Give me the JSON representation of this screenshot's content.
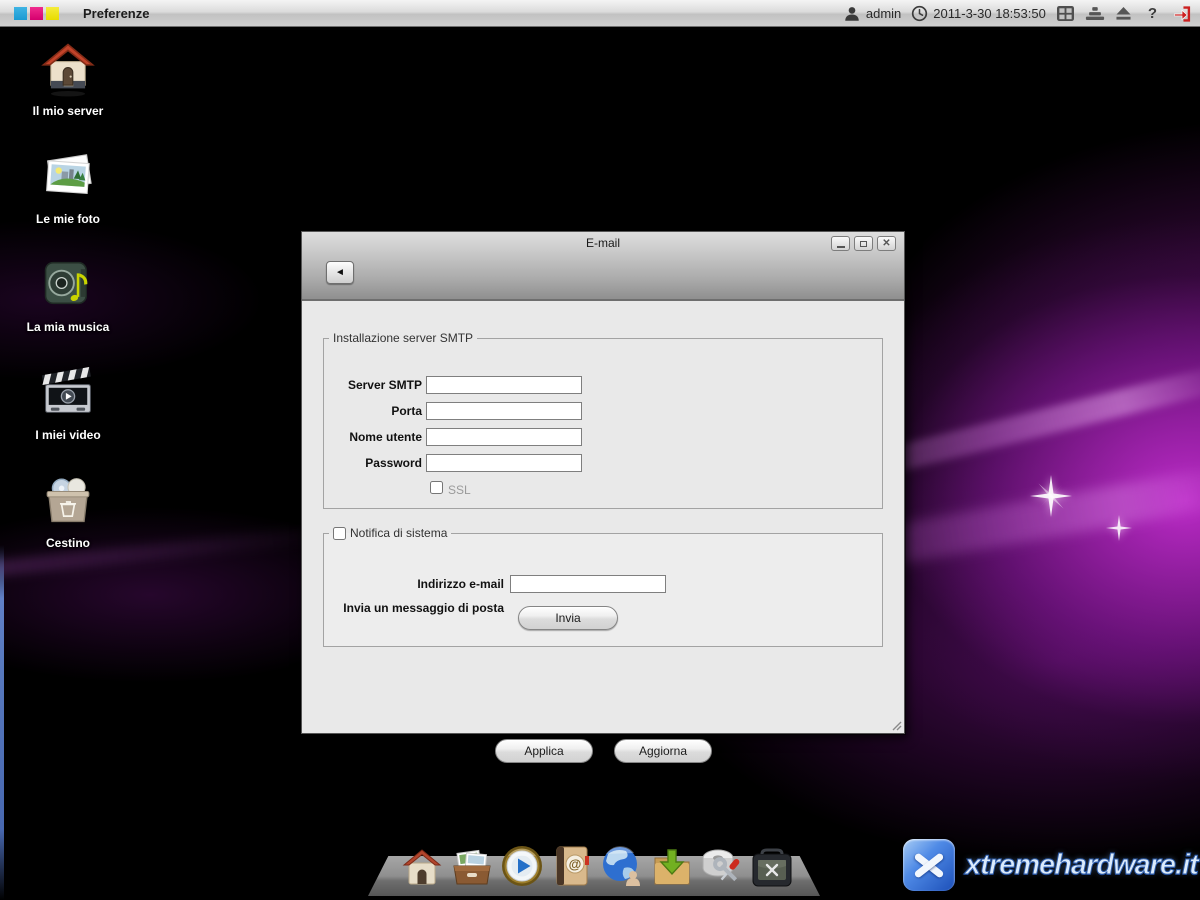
{
  "topbar": {
    "menu_label": "Preferenze",
    "user_name": "admin",
    "datetime": "2011-3-30 18:53:50",
    "help_glyph": "?"
  },
  "desktop_icons": [
    {
      "name": "my-server",
      "label": "Il mio server"
    },
    {
      "name": "my-photos",
      "label": "Le mie foto"
    },
    {
      "name": "my-music",
      "label": "La mia musica"
    },
    {
      "name": "my-videos",
      "label": "I miei video"
    },
    {
      "name": "recycle-bin",
      "label": "Cestino"
    }
  ],
  "dialog": {
    "title": "E-mail",
    "back_glyph": "◄",
    "minimize_glyph": "",
    "close_glyph": "",
    "smtp_section": {
      "legend": "Installazione server SMTP",
      "fields": [
        {
          "label": "Server SMTP",
          "value": ""
        },
        {
          "label": "Porta",
          "value": ""
        },
        {
          "label": "Nome utente",
          "value": ""
        },
        {
          "label": "Password",
          "value": ""
        }
      ],
      "ssl_label": "SSL",
      "ssl_checked": false
    },
    "notify_section": {
      "legend": "Notifica di sistema",
      "enabled": false,
      "email_label": "Indirizzo e-mail",
      "email_value": "",
      "send_label": "Invia un messaggio di posta",
      "send_button": "Invia"
    },
    "apply_button": "Applica",
    "refresh_button": "Aggiorna"
  },
  "dock": {
    "at_glyph": "@",
    "items": [
      "home",
      "photo-box",
      "media-player",
      "contacts",
      "web-access",
      "download-folder",
      "disk-tools",
      "toolbox"
    ]
  },
  "watermark": {
    "text": "xtremehardware.it"
  },
  "colors": {
    "wallpaper_purple": "#a020b8",
    "topbar_gray": "#cfcfcf",
    "dialog_body": "#e9e9e9",
    "logout_red": "#cc1f1f",
    "brand_blue": "#1b9ad2",
    "brand_magenta": "#d5006e",
    "brand_yellow": "#e8dc00",
    "logo_blue": "#2f6fd6"
  }
}
